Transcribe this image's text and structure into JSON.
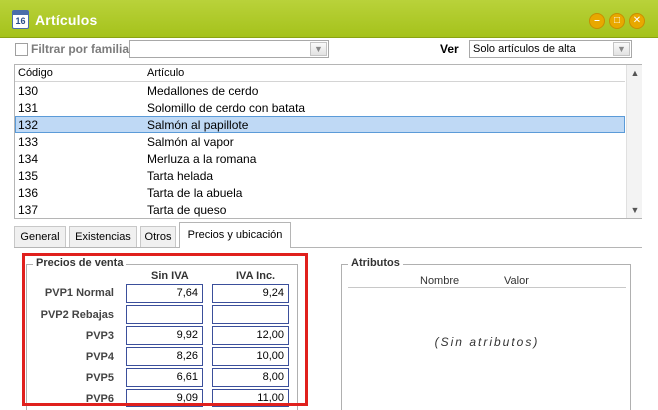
{
  "window": {
    "title": "Artículos",
    "icon_text": "16"
  },
  "filter": {
    "family_label": "Filtrar por familia",
    "family_value": "",
    "ver_label": "Ver",
    "ver_value": "Solo artículos de alta"
  },
  "list": {
    "headers": {
      "code": "Código",
      "article": "Artículo"
    },
    "rows": [
      {
        "code": "130",
        "article": "Medallones de cerdo"
      },
      {
        "code": "131",
        "article": "Solomillo de cerdo con batata"
      },
      {
        "code": "132",
        "article": "Salmón al papillote"
      },
      {
        "code": "133",
        "article": "Salmón al vapor"
      },
      {
        "code": "134",
        "article": "Merluza a la romana"
      },
      {
        "code": "135",
        "article": "Tarta helada"
      },
      {
        "code": "136",
        "article": "Tarta de la abuela"
      },
      {
        "code": "137",
        "article": "Tarta de queso"
      }
    ],
    "selected_code": "132"
  },
  "tabs": [
    "General",
    "Existencias",
    "Otros",
    "Precios y ubicación"
  ],
  "active_tab": "Precios y ubicación",
  "precios": {
    "title": "Precios de venta",
    "col_sin_iva": "Sin IVA",
    "col_iva_inc": "IVA Inc.",
    "rows": [
      {
        "label": "PVP1 Normal",
        "sin_iva": "7,64",
        "iva_inc": "9,24"
      },
      {
        "label": "PVP2 Rebajas",
        "sin_iva": "",
        "iva_inc": ""
      },
      {
        "label": "PVP3",
        "sin_iva": "9,92",
        "iva_inc": "12,00"
      },
      {
        "label": "PVP4",
        "sin_iva": "8,26",
        "iva_inc": "10,00"
      },
      {
        "label": "PVP5",
        "sin_iva": "6,61",
        "iva_inc": "8,00"
      },
      {
        "label": "PVP6",
        "sin_iva": "9,09",
        "iva_inc": "11,00"
      }
    ]
  },
  "atributos": {
    "title": "Atributos",
    "col_nombre": "Nombre",
    "col_valor": "Valor",
    "empty_text": "(Sin atributos)"
  },
  "colors": {
    "titlebar": "#a5c21b",
    "highlight": "#e0201d",
    "selection": "#bfd9f5",
    "input_border": "#3b4f9b"
  }
}
